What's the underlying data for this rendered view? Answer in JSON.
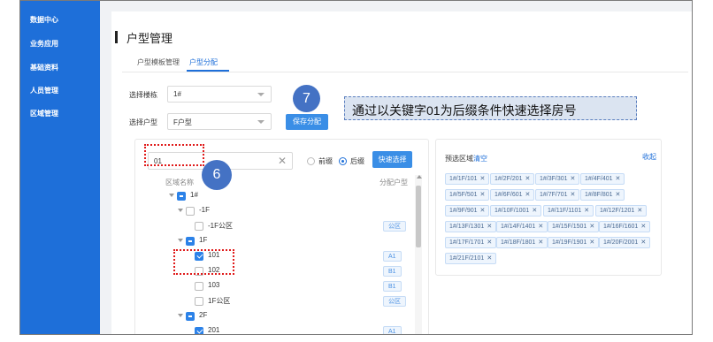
{
  "sidebar": {
    "items": [
      {
        "label": "数据中心"
      },
      {
        "label": "业务应用"
      },
      {
        "label": "基础资料"
      },
      {
        "label": "人员管理"
      },
      {
        "label": "区域管理"
      }
    ]
  },
  "page": {
    "title": "户型管理"
  },
  "tabs": [
    {
      "label": "户型模板管理"
    },
    {
      "label": "户型分配"
    }
  ],
  "form": {
    "building_label": "选择楼栋",
    "building_value": "1#",
    "type_label": "选择户型",
    "type_value": "F户型",
    "save_button": "保存分配"
  },
  "callouts": {
    "step7": "7",
    "step6": "6"
  },
  "annotation": "通过以关键字01为后缀条件快速选择房号",
  "search": {
    "value": "01",
    "prefix_label": "前缀",
    "suffix_label": "后缀",
    "quick_select_button": "快速选择"
  },
  "tree": {
    "col_name": "区域名称",
    "col_type": "分配户型",
    "rows": [
      {
        "label": "1#",
        "state": "indeterminate",
        "expandable": true,
        "tag": ""
      },
      {
        "label": "-1F",
        "state": "unchecked",
        "expandable": true,
        "tag": ""
      },
      {
        "label": "-1F公区",
        "state": "unchecked",
        "expandable": false,
        "tag": "公区"
      },
      {
        "label": "1F",
        "state": "indeterminate",
        "expandable": true,
        "tag": ""
      },
      {
        "label": "101",
        "state": "checked",
        "expandable": false,
        "tag": "A1"
      },
      {
        "label": "102",
        "state": "unchecked",
        "expandable": false,
        "tag": "B1"
      },
      {
        "label": "103",
        "state": "unchecked",
        "expandable": false,
        "tag": "B1"
      },
      {
        "label": "1F公区",
        "state": "unchecked",
        "expandable": false,
        "tag": "公区"
      },
      {
        "label": "2F",
        "state": "indeterminate",
        "expandable": true,
        "tag": ""
      },
      {
        "label": "201",
        "state": "checked",
        "expandable": false,
        "tag": "A1"
      }
    ]
  },
  "preselect": {
    "title": "预选区域",
    "clear_label": "清空",
    "collapse_label": "收起",
    "chips": [
      "1#/1F/101",
      "1#/2F/201",
      "1#/3F/301",
      "1#/4F/401",
      "1#/5F/501",
      "1#/6F/601",
      "1#/7F/701",
      "1#/8F/801",
      "1#/9F/901",
      "1#/10F/1001",
      "1#/11F/1101",
      "1#/12F/1201",
      "1#/13F/1301",
      "1#/14F/1401",
      "1#/15F/1501",
      "1#/16F/1601",
      "1#/17F/1701",
      "1#/18F/1801",
      "1#/19F/1901",
      "1#/20F/2001",
      "1#/21F/2101"
    ]
  },
  "colors": {
    "primary": "#1e6fd9",
    "callout": "#4472c4",
    "highlight_box": "#e01b1b"
  }
}
